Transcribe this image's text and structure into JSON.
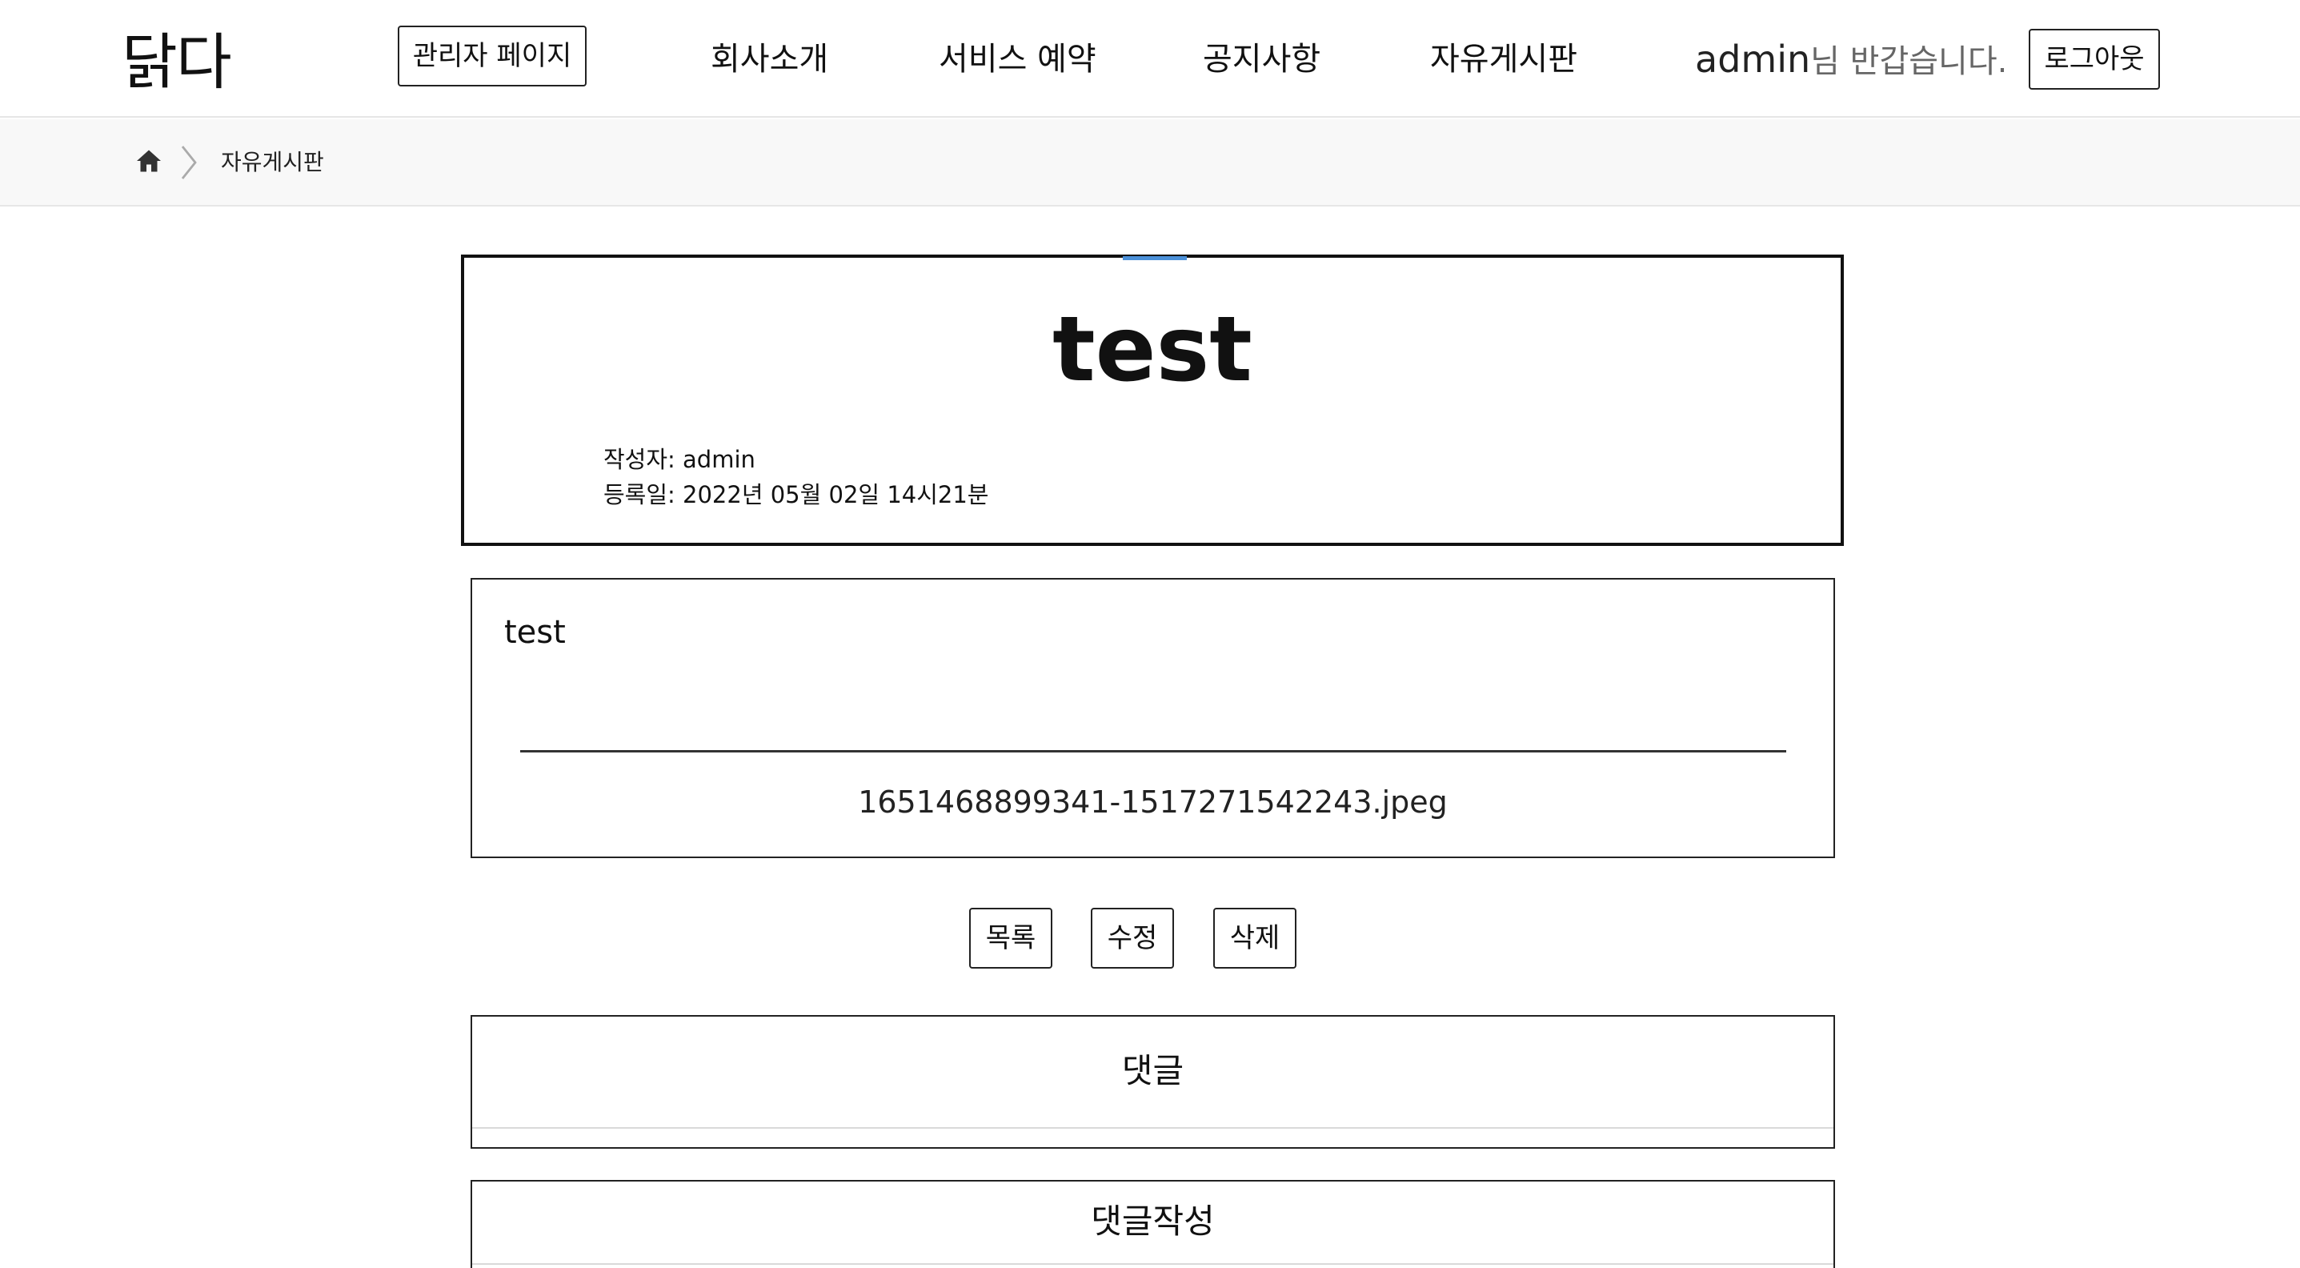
{
  "header": {
    "logo": "닭다",
    "admin_page_label": "관리자 페이지",
    "nav": [
      "회사소개",
      "서비스 예약",
      "공지사항",
      "자유게시판"
    ],
    "username": "admin",
    "greeting_suffix": "님 반갑습니다.",
    "logout_label": "로그아웃"
  },
  "breadcrumb": {
    "home_icon": "home-icon",
    "separator_icon": "chevron-right-icon",
    "current": "자유게시판"
  },
  "post": {
    "title": "test",
    "author_line": "작성자: admin",
    "date_line": "등록일: 2022년 05월 02일 14시21분",
    "content": "test",
    "attachment": "1651468899341-1517271542243.jpeg"
  },
  "actions": {
    "list_label": "목록",
    "edit_label": "수정",
    "delete_label": "삭제"
  },
  "comments": {
    "title": "댓글",
    "write_title": "댓글작성"
  },
  "colors": {
    "accent": "#4a90d9",
    "border": "#222222",
    "breadcrumb_bg": "#f8f8f8"
  }
}
